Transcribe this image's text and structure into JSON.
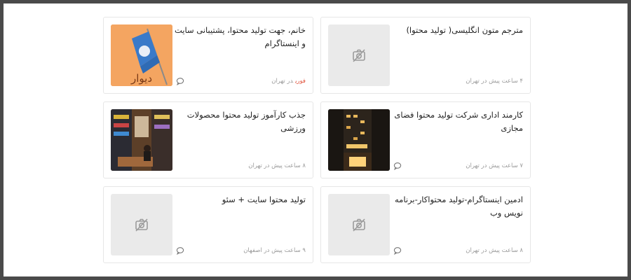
{
  "cards": [
    {
      "title": "مترجم متون انگلیسی( تولید محتوا)",
      "meta": "۴ ساعت پیش در تهران",
      "urgent": "",
      "image": "placeholder-no-image-icon",
      "chat_icon": false
    },
    {
      "title": "خانم، جهت تولید محتوا، پشتیبانی سایت و اینستاگرام",
      "meta": "در تهران",
      "urgent": "فوری",
      "image": "flag-photo",
      "image_text": "دیوار",
      "chat_icon": true
    },
    {
      "title": "کارمند اداری شرکت تولید محتوا فضای مجازی",
      "meta": "۷ ساعت پیش در تهران",
      "urgent": "",
      "image": "building-night-photo",
      "chat_icon": true
    },
    {
      "title": "جذب کارآموز تولید محتوا محصولات ورزشی",
      "meta": "۸ ساعت پیش در تهران",
      "urgent": "",
      "image": "shop-photo",
      "chat_icon": false
    },
    {
      "title": "ادمین اینستاگرام-تولید محتواکار-برنامه نویس وب",
      "meta": "۸ ساعت پیش در تهران",
      "urgent": "",
      "image": "placeholder-no-image-icon",
      "chat_icon": true
    },
    {
      "title": "تولید محتوا سایت + سئو",
      "meta": "۹ ساعت پیش در اصفهان",
      "urgent": "",
      "image": "placeholder-no-image-icon",
      "chat_icon": true
    }
  ]
}
